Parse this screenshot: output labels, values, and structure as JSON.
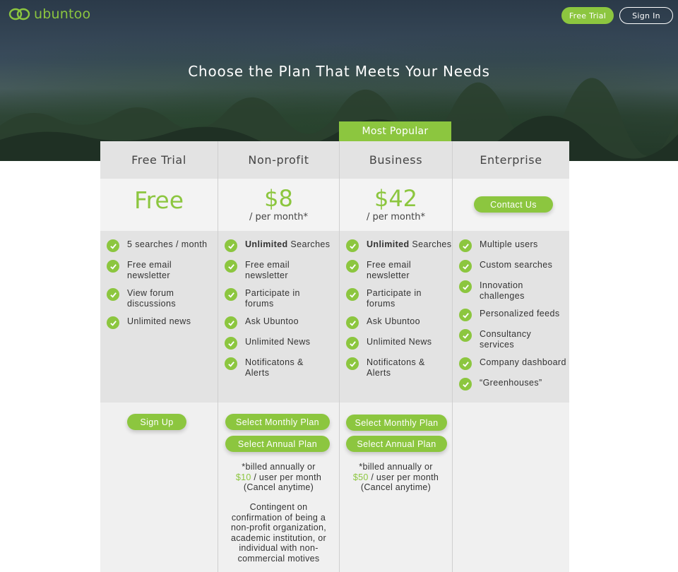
{
  "brand": {
    "name": "ubuntoo",
    "accent": "#8cc63f"
  },
  "nav": {
    "free_trial": "Free Trial",
    "sign_in": "Sign In"
  },
  "hero": {
    "title": "Choose the Plan That Meets Your Needs"
  },
  "badge": "Most Popular",
  "plans": [
    {
      "name": "Free Trial",
      "price": "Free",
      "features": [
        "5 searches / month",
        "Free email newsletter",
        "View forum discussions",
        "Unlimited news"
      ],
      "button": "Sign Up"
    },
    {
      "name": "Non-profit",
      "price": "$8",
      "per": "/ per month*",
      "features_first_bold": "Unlimited",
      "features_first_rest": " Searches",
      "features": [
        "Free email newsletter",
        "Participate in forums",
        "Ask Ubuntoo",
        "Unlimited News",
        "Notificatons & Alerts"
      ],
      "button_monthly": "Select Monthly Plan",
      "button_annual": "Select Annual Plan",
      "note_line1": "*billed annually or",
      "note_price": "$10",
      "note_line2_rest": " / user per month",
      "note_line3": "(Cancel anytime)",
      "extra_note": "Contingent on confirmation of being a non-profit organization, academic institution, or individual with non-commercial motives"
    },
    {
      "name": "Business",
      "price": "$42",
      "per": "/ per month*",
      "features_first_bold": "Unlimited",
      "features_first_rest": " Searches",
      "features": [
        "Free email newsletter",
        "Participate in forums",
        "Ask Ubuntoo",
        "Unlimited News",
        "Notificatons & Alerts"
      ],
      "button_monthly": "Select Monthly Plan",
      "button_annual": "Select Annual Plan",
      "note_line1": "*billed annually or",
      "note_price": "$50",
      "note_line2_rest": " / user per month",
      "note_line3": "(Cancel anytime)"
    },
    {
      "name": "Enterprise",
      "button": "Contact Us",
      "features": [
        "Multiple users",
        "Custom searches",
        "Innovation challenges",
        "Personalized feeds",
        "Consultancy services",
        "Company dashboard",
        "“Greenhouses”"
      ]
    }
  ]
}
